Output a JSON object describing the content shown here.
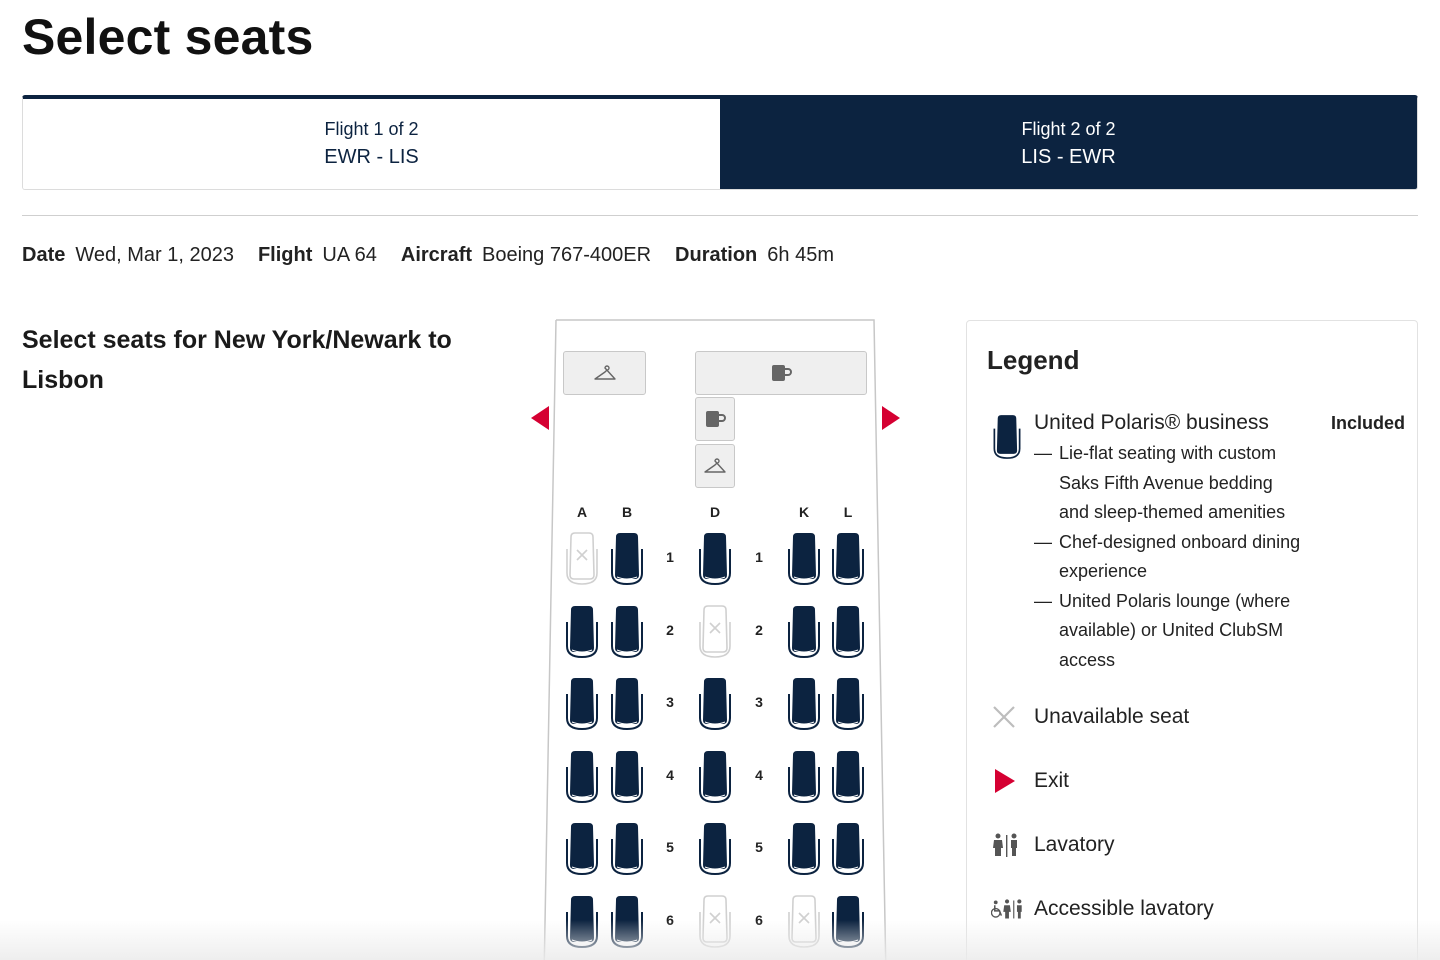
{
  "page": {
    "title": "Select seats"
  },
  "tabs": [
    {
      "sub": "Flight 1 of 2",
      "route": "EWR - LIS",
      "active": false
    },
    {
      "sub": "Flight 2 of 2",
      "route": "LIS - EWR",
      "active": true
    }
  ],
  "flight_info": {
    "date_label": "Date",
    "date": "Wed, Mar 1, 2023",
    "flight_label": "Flight",
    "flight": "UA 64",
    "aircraft_label": "Aircraft",
    "aircraft": "Boeing 767-400ER",
    "duration_label": "Duration",
    "duration": "6h 45m"
  },
  "route_heading": "Select seats for New York/Newark to Lisbon",
  "seatmap": {
    "columns": [
      "A",
      "B",
      "D",
      "K",
      "L"
    ],
    "rows": [
      {
        "num": "1",
        "seats": {
          "A": "unavailable",
          "B": "available",
          "D": "available",
          "K": "available",
          "L": "available"
        }
      },
      {
        "num": "2",
        "seats": {
          "A": "available",
          "B": "available",
          "D": "unavailable",
          "K": "available",
          "L": "available"
        }
      },
      {
        "num": "3",
        "seats": {
          "A": "available",
          "B": "available",
          "D": "available",
          "K": "available",
          "L": "available"
        }
      },
      {
        "num": "4",
        "seats": {
          "A": "available",
          "B": "available",
          "D": "available",
          "K": "available",
          "L": "available"
        }
      },
      {
        "num": "5",
        "seats": {
          "A": "available",
          "B": "available",
          "D": "available",
          "K": "available",
          "L": "available"
        }
      },
      {
        "num": "6",
        "seats": {
          "A": "available",
          "B": "available",
          "D": "unavailable",
          "K": "unavailable",
          "L": "available"
        }
      }
    ],
    "colors": {
      "seat": "#0c2340",
      "unavailable": "#d0d0d0",
      "exit": "#d50032",
      "galley": "#efefef"
    },
    "icons": [
      "closet-icon",
      "galley-icon",
      "exit-icon"
    ]
  },
  "legend": {
    "title": "Legend",
    "cabin_name": "United Polaris® business",
    "cabin_price": "Included",
    "features": [
      "Lie-flat seating with custom Saks Fifth Avenue bedding and sleep-themed amenities",
      "Chef-designed onboard dining experience",
      "United Polaris lounge (where available) or United ClubSM access"
    ],
    "dash": "—",
    "items": [
      {
        "icon": "unavailable-x-icon",
        "label": "Unavailable seat"
      },
      {
        "icon": "exit-icon",
        "label": "Exit"
      },
      {
        "icon": "lavatory-icon",
        "label": "Lavatory"
      },
      {
        "icon": "accessible-lavatory-icon",
        "label": "Accessible lavatory"
      }
    ]
  }
}
